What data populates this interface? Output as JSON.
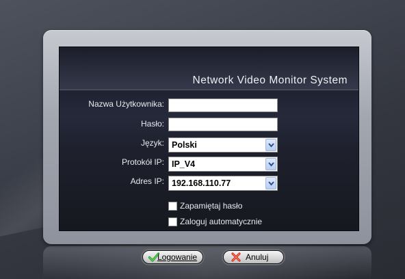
{
  "window": {
    "app_title": "Network Video Monitor System"
  },
  "form": {
    "username": {
      "label": "Nazwa Użytkownika:",
      "value": ""
    },
    "password": {
      "label": "Hasło:",
      "value": ""
    },
    "language": {
      "label": "Język:",
      "selected": "Polski"
    },
    "ip_protocol": {
      "label": "Protokół IP:",
      "selected": "IP_V4"
    },
    "ip_address": {
      "label": "Adres IP:",
      "selected": "192.168.110.77"
    },
    "remember_password": {
      "label": "Zapamiętaj hasło",
      "checked": false
    },
    "auto_login": {
      "label": "Zaloguj automatycznie",
      "checked": false
    }
  },
  "buttons": {
    "login": {
      "label": "Logowanie",
      "icon": "green-checkmark-icon"
    },
    "cancel": {
      "label": "Anuluj",
      "icon": "red-x-icon"
    }
  },
  "colors": {
    "title_text": "#eef0f4",
    "panel_bg": "#1e212d",
    "frame": "#a3a7b0",
    "dropdown_button": "#b7cdf2"
  }
}
